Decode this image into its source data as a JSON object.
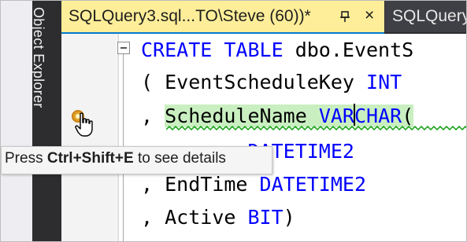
{
  "side_panel": {
    "label": "Object Explorer"
  },
  "tabs": [
    {
      "title": "SQLQuery3.sql...TO\\Steve (60))*",
      "pin_icon": "pin-icon",
      "close_glyph": "×",
      "active": true
    },
    {
      "title": "SQLQuery",
      "active": false
    }
  ],
  "code": {
    "line1": {
      "kw1": "CREATE",
      "kw2": "TABLE",
      "text": "dbo.EventS"
    },
    "line2": {
      "prefix": "(",
      "text": "EventScheduleKey",
      "kw": "INT"
    },
    "line3": {
      "prefix": ",",
      "text": "ScheduleName",
      "kw_a": "VAR",
      "kw_b": "CHAR",
      "suffix": "("
    },
    "line4": {
      "prefix": "",
      "text": "me",
      "kw": "DATETIME2"
    },
    "line5": {
      "prefix": ",",
      "text": "EndTime",
      "kw": "DATETIME2"
    },
    "line6": {
      "prefix": ",",
      "text": "Active",
      "kw": "BIT",
      "suffix": ")"
    }
  },
  "tooltip": {
    "pre": "Press ",
    "keys": "Ctrl+Shift+E",
    "post": " to see details"
  },
  "colors": {
    "keyword": "#0000ff",
    "tab_active_bg": "#ffee99",
    "squiggle": "#12a012",
    "highlight": "#c9efc1"
  },
  "icons": [
    "lightbulb-icon",
    "hand-cursor-icon",
    "collapse-icon",
    "pin-icon"
  ]
}
